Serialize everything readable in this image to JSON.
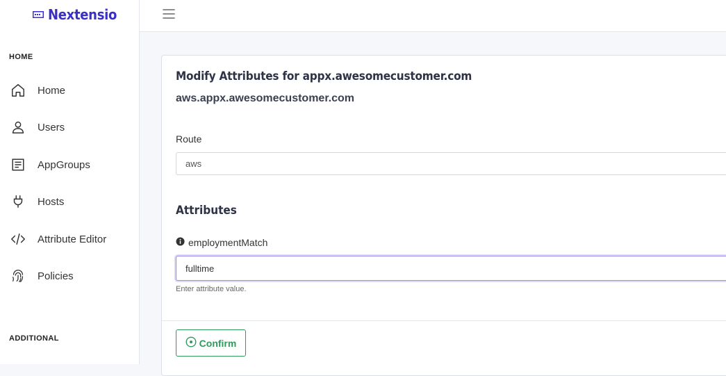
{
  "brand": {
    "name": "Nextensio",
    "color": "#3b2fc9"
  },
  "sidebar": {
    "home_section": "HOME",
    "additional_section": "ADDITIONAL",
    "items": [
      {
        "label": "Home",
        "icon": "home-icon"
      },
      {
        "label": "Users",
        "icon": "user-icon"
      },
      {
        "label": "AppGroups",
        "icon": "document-icon"
      },
      {
        "label": "Hosts",
        "icon": "plug-icon"
      },
      {
        "label": "Attribute Editor",
        "icon": "code-icon"
      },
      {
        "label": "Policies",
        "icon": "fingerprint-icon"
      }
    ]
  },
  "form": {
    "title": "Modify Attributes for appx.awesomecustomer.com",
    "subtitle": "aws.appx.awesomecustomer.com",
    "route_label": "Route",
    "route_value": "aws",
    "attributes_heading": "Attributes",
    "attribute_name": "employmentMatch",
    "attribute_value": "fulltime",
    "attribute_help": "Enter attribute value.",
    "confirm_label": "Confirm",
    "confirm_color": "#2e9b5a"
  }
}
